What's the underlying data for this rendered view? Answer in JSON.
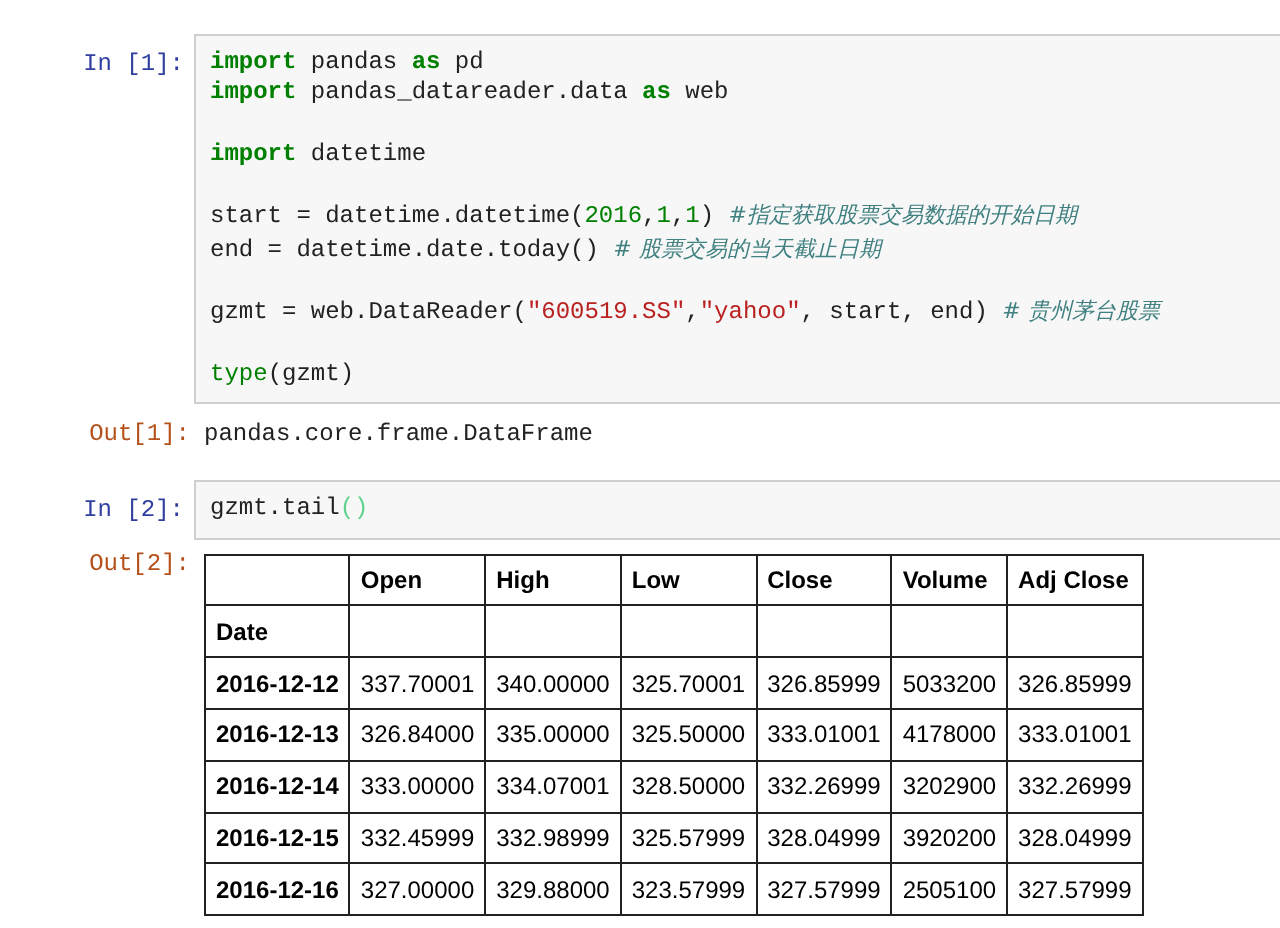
{
  "cells": [
    {
      "prompt": "In [1]:",
      "code": [
        {
          "tokens": [
            {
              "kind": "keyword",
              "text": "import"
            },
            {
              "kind": "plain",
              "text": " pandas "
            },
            {
              "kind": "keyword",
              "text": "as"
            },
            {
              "kind": "plain",
              "text": " pd"
            }
          ]
        },
        {
          "tokens": [
            {
              "kind": "keyword",
              "text": "import"
            },
            {
              "kind": "plain",
              "text": " pandas_datareader.data "
            },
            {
              "kind": "keyword",
              "text": "as"
            },
            {
              "kind": "plain",
              "text": " web"
            }
          ]
        },
        {
          "gap_before": true,
          "tokens": [
            {
              "kind": "keyword",
              "text": "import"
            },
            {
              "kind": "plain",
              "text": " datetime"
            }
          ]
        },
        {
          "gap_before": true,
          "tokens": [
            {
              "kind": "plain",
              "text": "start = datetime.datetime("
            },
            {
              "kind": "number",
              "text": "2016"
            },
            {
              "kind": "plain",
              "text": ","
            },
            {
              "kind": "number",
              "text": "1"
            },
            {
              "kind": "plain",
              "text": ","
            },
            {
              "kind": "number",
              "text": "1"
            },
            {
              "kind": "plain",
              "text": ") "
            },
            {
              "kind": "comment",
              "text": "#指定获取股票交易数据的开始日期"
            }
          ]
        },
        {
          "tokens": [
            {
              "kind": "plain",
              "text": "end = datetime.date.today() "
            },
            {
              "kind": "comment",
              "text": "# 股票交易的当天截止日期"
            }
          ]
        },
        {
          "gap_before": true,
          "tokens": [
            {
              "kind": "plain",
              "text": "gzmt = web.DataReader("
            },
            {
              "kind": "string",
              "text": "\"600519.SS\""
            },
            {
              "kind": "plain",
              "text": ","
            },
            {
              "kind": "string",
              "text": "\"yahoo\""
            },
            {
              "kind": "plain",
              "text": ", start, end) "
            },
            {
              "kind": "comment",
              "text": "# 贵州茅台股票"
            }
          ]
        },
        {
          "gap_before": true,
          "tokens": [
            {
              "kind": "builtin",
              "text": "type"
            },
            {
              "kind": "plain",
              "text": "(gzmt)"
            }
          ]
        }
      ],
      "output": {
        "prompt": "Out[1]:",
        "kind": "text",
        "text": "pandas.core.frame.DataFrame"
      }
    },
    {
      "prompt": "In [2]:",
      "code": [
        {
          "tokens": [
            {
              "kind": "plain",
              "text": "gzmt.tail"
            },
            {
              "kind": "bracket_match",
              "text": "()"
            }
          ]
        }
      ],
      "output": {
        "prompt": "Out[2]:",
        "kind": "table",
        "columns": [
          "Open",
          "High",
          "Low",
          "Close",
          "Volume",
          "Adj Close"
        ],
        "index_name": "Date",
        "rows": [
          {
            "index": "2016-12-12",
            "cells": [
              "337.70001",
              "340.00000",
              "325.70001",
              "326.85999",
              "5033200",
              "326.85999"
            ]
          },
          {
            "index": "2016-12-13",
            "cells": [
              "326.84000",
              "335.00000",
              "325.50000",
              "333.01001",
              "4178000",
              "333.01001"
            ]
          },
          {
            "index": "2016-12-14",
            "cells": [
              "333.00000",
              "334.07001",
              "328.50000",
              "332.26999",
              "3202900",
              "332.26999"
            ]
          },
          {
            "index": "2016-12-15",
            "cells": [
              "332.45999",
              "332.98999",
              "325.57999",
              "328.04999",
              "3920200",
              "328.04999"
            ]
          },
          {
            "index": "2016-12-16",
            "cells": [
              "327.00000",
              "329.88000",
              "323.57999",
              "327.57999",
              "2505100",
              "327.57999"
            ]
          }
        ]
      }
    }
  ]
}
